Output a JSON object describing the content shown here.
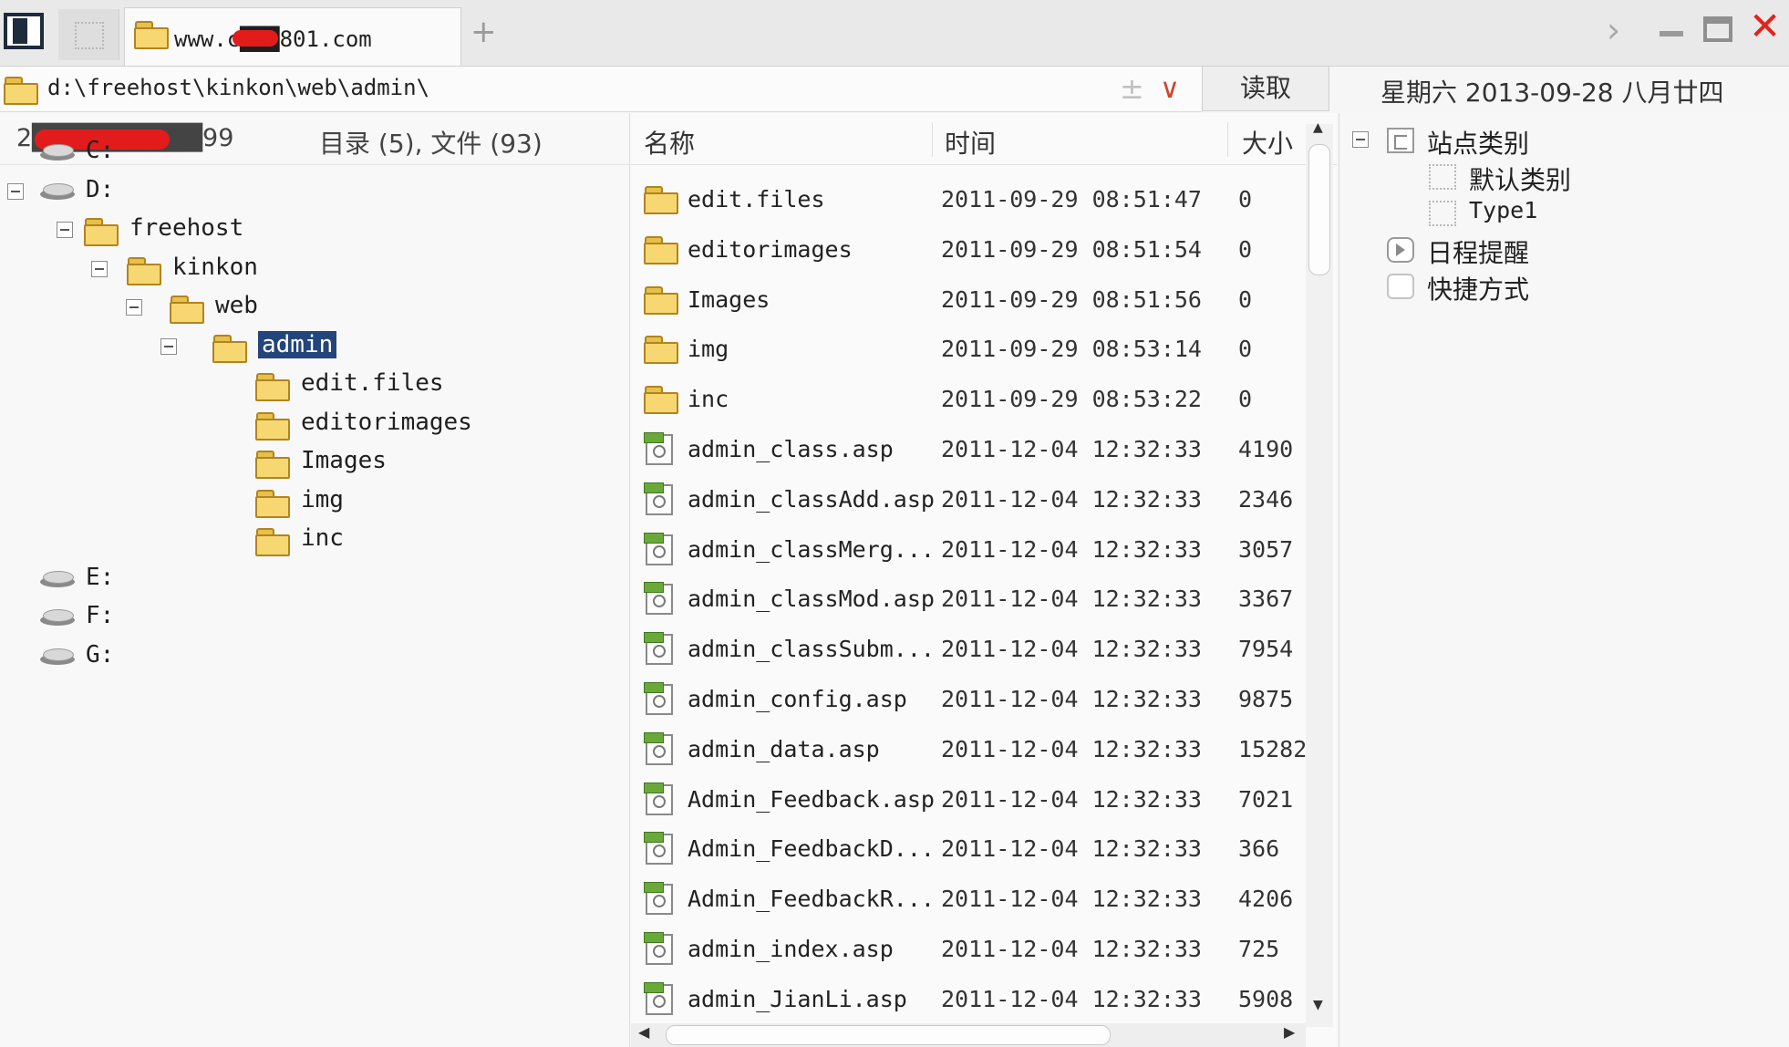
{
  "tab": {
    "title": "www.c███801.com",
    "add_symbol": "+"
  },
  "window": {
    "next_symbol": "›",
    "close_symbol": "✕"
  },
  "address": {
    "path": "d:\\freehost\\kinkon\\web\\admin\\",
    "add_symbol": "±",
    "drop_symbol": "∨"
  },
  "read_button": "读取",
  "date": "星期六 2013-09-28 八月廿四",
  "left_header": {
    "account": "2█████████99",
    "summary": "目录 (5), 文件 (93)"
  },
  "tree": [
    {
      "label": "C:",
      "type": "drive",
      "depth": 0,
      "expander": false
    },
    {
      "label": "D:",
      "type": "drive",
      "depth": 0,
      "expander": true
    },
    {
      "label": "freehost",
      "type": "folder",
      "depth": 1,
      "expander": true
    },
    {
      "label": "kinkon",
      "type": "folder",
      "depth": 2,
      "expander": true
    },
    {
      "label": "web",
      "type": "folder",
      "depth": 3,
      "expander": true
    },
    {
      "label": "admin",
      "type": "folder",
      "depth": 4,
      "expander": true,
      "selected": true
    },
    {
      "label": "edit.files",
      "type": "folder",
      "depth": 5,
      "expander": false
    },
    {
      "label": "editorimages",
      "type": "folder",
      "depth": 5,
      "expander": false
    },
    {
      "label": "Images",
      "type": "folder",
      "depth": 5,
      "expander": false
    },
    {
      "label": "img",
      "type": "folder",
      "depth": 5,
      "expander": false
    },
    {
      "label": "inc",
      "type": "folder",
      "depth": 5,
      "expander": false
    },
    {
      "label": "E:",
      "type": "drive",
      "depth": 0,
      "expander": false
    },
    {
      "label": "F:",
      "type": "drive",
      "depth": 0,
      "expander": false
    },
    {
      "label": "G:",
      "type": "drive",
      "depth": 0,
      "expander": false
    }
  ],
  "file_columns": {
    "name": "名称",
    "time": "时间",
    "size": "大小"
  },
  "files": [
    {
      "name": "edit.files",
      "time": "2011-09-29 08:51:47",
      "size": "0",
      "type": "folder"
    },
    {
      "name": "editorimages",
      "time": "2011-09-29 08:51:54",
      "size": "0",
      "type": "folder"
    },
    {
      "name": "Images",
      "time": "2011-09-29 08:51:56",
      "size": "0",
      "type": "folder"
    },
    {
      "name": "img",
      "time": "2011-09-29 08:53:14",
      "size": "0",
      "type": "folder"
    },
    {
      "name": "inc",
      "time": "2011-09-29 08:53:22",
      "size": "0",
      "type": "folder"
    },
    {
      "name": "admin_class.asp",
      "time": "2011-12-04 12:32:33",
      "size": "4190",
      "type": "asp"
    },
    {
      "name": "admin_classAdd.asp",
      "time": "2011-12-04 12:32:33",
      "size": "2346",
      "type": "asp"
    },
    {
      "name": "admin_classMerg...",
      "time": "2011-12-04 12:32:33",
      "size": "3057",
      "type": "asp"
    },
    {
      "name": "admin_classMod.asp",
      "time": "2011-12-04 12:32:33",
      "size": "3367",
      "type": "asp"
    },
    {
      "name": "admin_classSubm...",
      "time": "2011-12-04 12:32:33",
      "size": "7954",
      "type": "asp"
    },
    {
      "name": "admin_config.asp",
      "time": "2011-12-04 12:32:33",
      "size": "9875",
      "type": "asp"
    },
    {
      "name": "admin_data.asp",
      "time": "2011-12-04 12:32:33",
      "size": "15282",
      "type": "asp"
    },
    {
      "name": "Admin_Feedback.asp",
      "time": "2011-12-04 12:32:33",
      "size": "7021",
      "type": "asp"
    },
    {
      "name": "Admin_FeedbackD...",
      "time": "2011-12-04 12:32:33",
      "size": "366",
      "type": "asp"
    },
    {
      "name": "Admin_FeedbackR...",
      "time": "2011-12-04 12:32:33",
      "size": "4206",
      "type": "asp"
    },
    {
      "name": "admin_index.asp",
      "time": "2011-12-04 12:32:33",
      "size": "725",
      "type": "asp"
    },
    {
      "name": "admin_JianLi.asp",
      "time": "2011-12-04 12:32:33",
      "size": "5908",
      "type": "asp"
    }
  ],
  "right_tree": [
    {
      "label": "站点类别",
      "icon": "category-icon",
      "level": 0,
      "expander": true
    },
    {
      "label": "默认类别",
      "icon": "dotted-box-icon",
      "level": 1,
      "expander": false
    },
    {
      "label": "Type1",
      "icon": "dotted-box-icon",
      "level": 1,
      "expander": false,
      "mono": true
    },
    {
      "label": "日程提醒",
      "icon": "schedule-icon",
      "level": 0,
      "expander": false
    },
    {
      "label": "快捷方式",
      "icon": "shortcut-icon",
      "level": 0,
      "expander": false
    }
  ],
  "colors": {
    "selection": "#24457c",
    "close": "#e2231a",
    "folder": "#f6d772",
    "redaction": "#e21c1c"
  }
}
